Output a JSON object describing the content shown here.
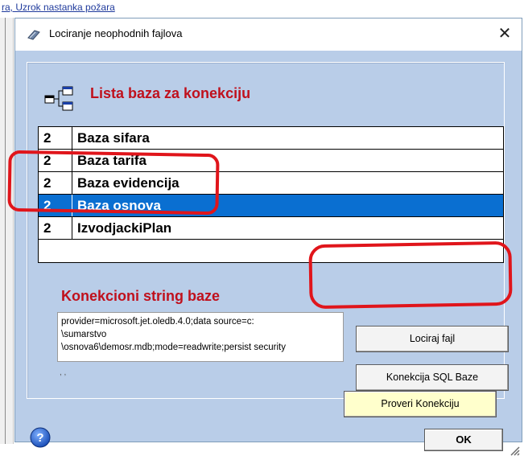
{
  "background": {
    "link_text": "ra, Uzrok nastanka požara"
  },
  "dialog": {
    "title": "Lociranje neophodnih fajlova",
    "close_glyph": "✕"
  },
  "list_section": {
    "title": "Lista baza za konekciju",
    "rows": [
      {
        "num": "2",
        "name": "Baza sifara",
        "selected": false
      },
      {
        "num": "2",
        "name": "Baza tarifa",
        "selected": false
      },
      {
        "num": "2",
        "name": "Baza evidencija",
        "selected": false
      },
      {
        "num": "2",
        "name": "Baza osnova",
        "selected": true
      },
      {
        "num": "2",
        "name": "IzvodjackiPlan",
        "selected": false
      }
    ]
  },
  "connection_section": {
    "title": "Konekcioni string baze",
    "string_lines": [
      "provider=microsoft.jet.oledb.4.0;data source=c:",
      "\\sumarstvo",
      "\\osnova6\\demosr.mdb;mode=readwrite;persist security"
    ],
    "status_text": ", ,"
  },
  "buttons": {
    "locate": "Lociraj fajl",
    "sql": "Konekcija SQL Baze",
    "check": "Proveri Konekciju",
    "ok": "OK"
  },
  "icons": {
    "title": "book-icon",
    "list": "database-tree-icon",
    "help": "help-icon",
    "grip": "resize-grip-icon"
  },
  "colors": {
    "accent_red": "#c0101c",
    "selection_blue": "#0a6fd1",
    "annotation_red": "#e0151b",
    "check_button_bg": "#ffffcc"
  }
}
